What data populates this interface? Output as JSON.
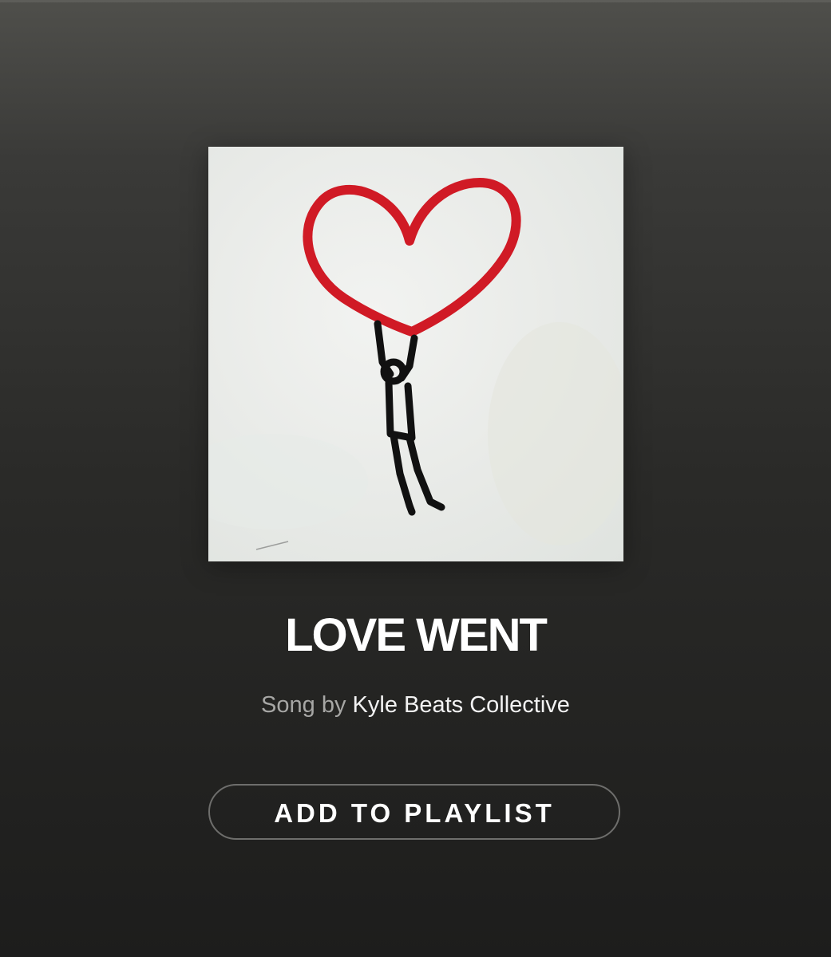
{
  "song": {
    "title": "LOVE WENT",
    "byline_prefix": "Song by ",
    "artist": "Kyle Beats Collective"
  },
  "cover": {
    "icon": "heart-balloon-stick-figure-artwork"
  },
  "actions": {
    "add_to_playlist_label": "ADD TO PLAYLIST"
  },
  "colors": {
    "heart": "#d01a25",
    "figure": "#111111",
    "text_primary": "#ffffff",
    "text_secondary": "#a7a7a5",
    "button_border": "#6e6e6c"
  }
}
